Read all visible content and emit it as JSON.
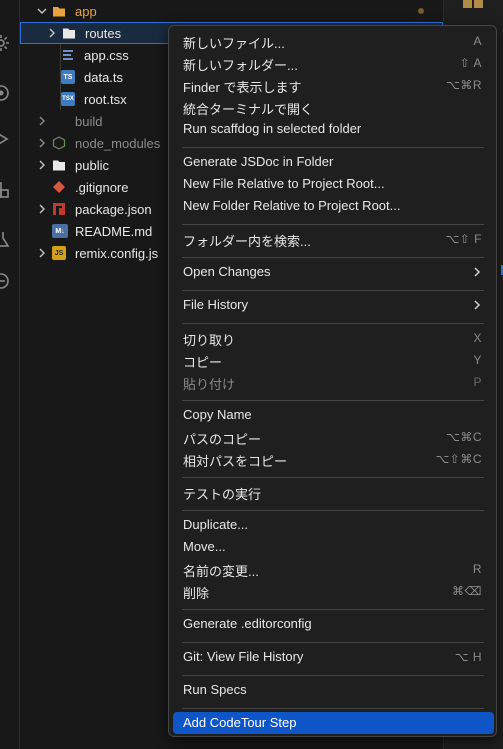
{
  "activity_bar": {
    "icons": [
      "settings-icon",
      "source-control-icon",
      "run-debug-icon",
      "extensions-icon",
      "testing-icon",
      "remote-icon"
    ]
  },
  "explorer": {
    "items": [
      {
        "label": "app",
        "color": "#e8a33d",
        "kind": "folder-open"
      },
      {
        "label": "routes",
        "color": "#e8e8e8",
        "kind": "folder"
      },
      {
        "label": "app.css",
        "color": "#e8e8e8",
        "kind": "css"
      },
      {
        "label": "data.ts",
        "color": "#e8e8e8",
        "kind": "ts"
      },
      {
        "label": "root.tsx",
        "color": "#e8e8e8",
        "kind": "tsx"
      },
      {
        "label": "build",
        "color": "#8c8c8c",
        "kind": "folder"
      },
      {
        "label": "node_modules",
        "color": "#8c8c8c",
        "kind": "node-folder"
      },
      {
        "label": "public",
        "color": "#e8e8e8",
        "kind": "folder"
      },
      {
        "label": ".gitignore",
        "color": "#e8e8e8",
        "kind": "git"
      },
      {
        "label": "package.json",
        "color": "#e8e8e8",
        "kind": "npm"
      },
      {
        "label": "README.md",
        "color": "#e8e8e8",
        "kind": "md"
      },
      {
        "label": "remix.config.js",
        "color": "#e8e8e8",
        "kind": "js"
      }
    ],
    "icon_text": {
      "ts": "TS",
      "tsx": "TSX",
      "md": "M↓",
      "js": "JS"
    }
  },
  "context_menu": {
    "items": [
      {
        "label": "新しいファイル...",
        "shortcut": "A"
      },
      {
        "label": "新しいフォルダー...",
        "shortcut": "⇧ A"
      },
      {
        "label": "Finder で表示します",
        "shortcut": "⌥⌘R"
      },
      {
        "label": "統合ターミナルで開く",
        "shortcut": ""
      },
      {
        "label": "Run scaffdog in selected folder",
        "shortcut": ""
      },
      {
        "label": "Generate JSDoc in Folder",
        "shortcut": ""
      },
      {
        "label": "New File Relative to Project Root...",
        "shortcut": ""
      },
      {
        "label": "New Folder Relative to Project Root...",
        "shortcut": ""
      },
      {
        "label": "フォルダー内を検索...",
        "shortcut": "⌥⇧ F"
      },
      {
        "label": "Open Changes",
        "shortcut": "",
        "submenu": true
      },
      {
        "label": "File History",
        "shortcut": "",
        "submenu": true
      },
      {
        "label": "切り取り",
        "shortcut": "X"
      },
      {
        "label": "コピー",
        "shortcut": "Y"
      },
      {
        "label": "貼り付け",
        "shortcut": "P",
        "disabled": true
      },
      {
        "label": "Copy Name",
        "shortcut": ""
      },
      {
        "label": "パスのコピー",
        "shortcut": "⌥⌘C"
      },
      {
        "label": "相対パスをコピー",
        "shortcut": "⌥⇧⌘C"
      },
      {
        "label": "テストの実行",
        "shortcut": ""
      },
      {
        "label": "Duplicate...",
        "shortcut": ""
      },
      {
        "label": "Move...",
        "shortcut": ""
      },
      {
        "label": "名前の変更...",
        "shortcut": "R"
      },
      {
        "label": "削除",
        "shortcut": "⌘⌫"
      },
      {
        "label": "Generate .editorconfig",
        "shortcut": ""
      },
      {
        "label": "Git: View File History",
        "shortcut": "⌥ H"
      },
      {
        "label": "Run Specs",
        "shortcut": ""
      },
      {
        "label": "Add CodeTour Step",
        "shortcut": "",
        "selected": true
      }
    ]
  },
  "colors": {
    "accent": "#0e55c8",
    "folder_highlight": "#e8a33d",
    "selection_outline": "#2f6fd8"
  }
}
